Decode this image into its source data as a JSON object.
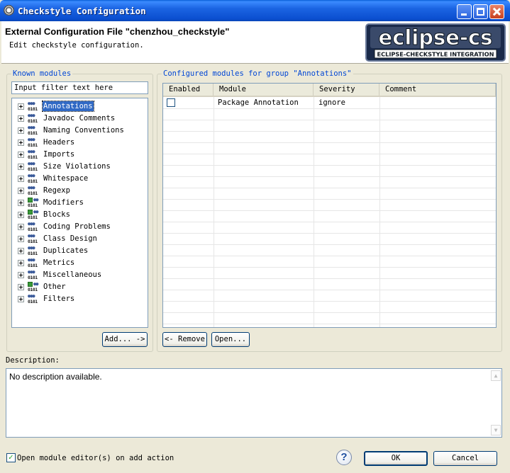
{
  "window": {
    "title": "Checkstyle Configuration"
  },
  "header": {
    "title": "External Configuration File \"chenzhou_checkstyle\"",
    "subtitle": "Edit checkstyle configuration.",
    "logo_main": "eclipse-cs",
    "logo_tagline": "ECLIPSE-CHECKSTYLE INTEGRATION"
  },
  "known_modules": {
    "label": "Known modules",
    "filter_value": "Input filter text here",
    "items": [
      {
        "label": "Annotations",
        "selected": true,
        "icon": "people-binary-icon"
      },
      {
        "label": "Javadoc Comments",
        "selected": false,
        "icon": "people-binary-icon"
      },
      {
        "label": "Naming Conventions",
        "selected": false,
        "icon": "people-binary-icon"
      },
      {
        "label": "Headers",
        "selected": false,
        "icon": "people-binary-icon"
      },
      {
        "label": "Imports",
        "selected": false,
        "icon": "people-binary-icon"
      },
      {
        "label": "Size Violations",
        "selected": false,
        "icon": "people-binary-icon"
      },
      {
        "label": "Whitespace",
        "selected": false,
        "icon": "people-binary-icon"
      },
      {
        "label": "Regexp",
        "selected": false,
        "icon": "people-binary-icon"
      },
      {
        "label": "Modifiers",
        "selected": false,
        "icon": "checked-binary-icon"
      },
      {
        "label": "Blocks",
        "selected": false,
        "icon": "checked-binary-icon"
      },
      {
        "label": "Coding Problems",
        "selected": false,
        "icon": "people-binary-icon"
      },
      {
        "label": "Class Design",
        "selected": false,
        "icon": "people-binary-icon"
      },
      {
        "label": "Duplicates",
        "selected": false,
        "icon": "people-binary-icon"
      },
      {
        "label": "Metrics",
        "selected": false,
        "icon": "people-binary-icon"
      },
      {
        "label": "Miscellaneous",
        "selected": false,
        "icon": "people-binary-icon"
      },
      {
        "label": "Other",
        "selected": false,
        "icon": "checked-binary-icon"
      },
      {
        "label": "Filters",
        "selected": false,
        "icon": "people-binary-icon"
      }
    ],
    "add_button": "Add... ->"
  },
  "configured_modules": {
    "label": "Configured modules for group \"Annotations\"",
    "columns": [
      "Enabled",
      "Module",
      "Severity",
      "Comment"
    ],
    "rows": [
      {
        "enabled": false,
        "module": "Package Annotation",
        "severity": "ignore",
        "comment": ""
      }
    ],
    "remove_button": "<- Remove",
    "open_button": "Open..."
  },
  "description": {
    "label": "Description:",
    "text": "No description available."
  },
  "footer": {
    "open_editor_checkbox": "Open module editor(s) on add action",
    "open_editor_checked": true,
    "ok_button": "OK",
    "cancel_button": "Cancel",
    "help_symbol": "?"
  },
  "colors": {
    "titlebar": "#0b4fd0",
    "group_label": "#0046d5",
    "selection": "#316ac5",
    "window_bg": "#ece9d8"
  }
}
